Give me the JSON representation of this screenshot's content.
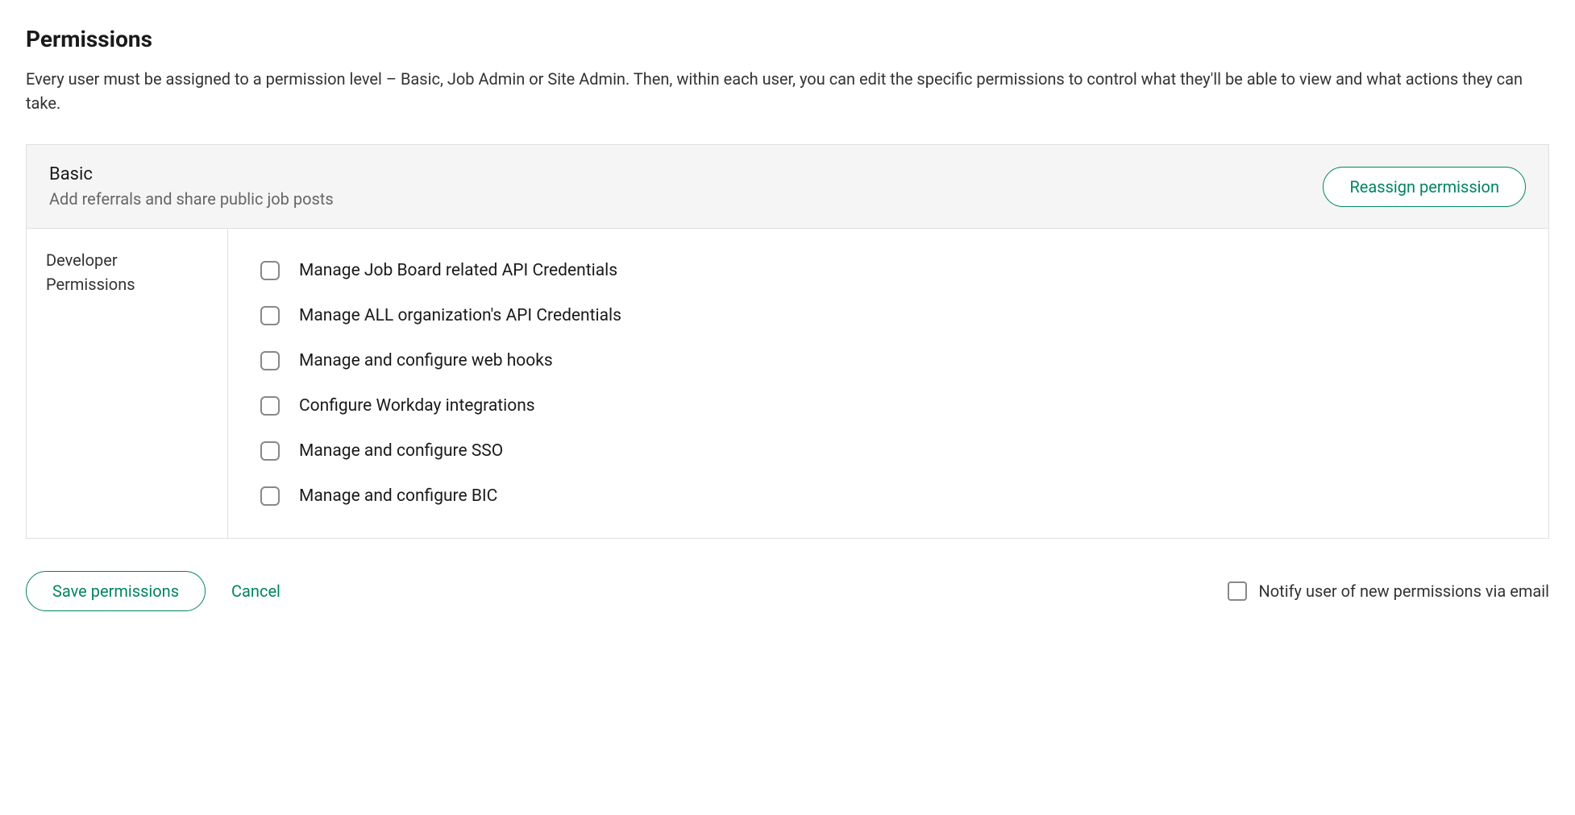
{
  "header": {
    "title": "Permissions",
    "description": "Every user must be assigned to a permission level – Basic, Job Admin or Site Admin. Then, within each user, you can edit the specific permissions to control what they'll be able to view and what actions they can take."
  },
  "panel": {
    "title": "Basic",
    "subtitle": "Add referrals and share public job posts",
    "reassign_label": "Reassign permission"
  },
  "sidebar": {
    "items": [
      {
        "label": "Developer Permissions"
      }
    ]
  },
  "permissions": [
    {
      "label": "Manage Job Board related API Credentials",
      "checked": false
    },
    {
      "label": "Manage ALL organization's API Credentials",
      "checked": false
    },
    {
      "label": "Manage and configure web hooks",
      "checked": false
    },
    {
      "label": "Configure Workday integrations",
      "checked": false
    },
    {
      "label": "Manage and configure SSO",
      "checked": false
    },
    {
      "label": "Manage and configure BIC",
      "checked": false
    }
  ],
  "footer": {
    "save_label": "Save permissions",
    "cancel_label": "Cancel",
    "notify_label": "Notify user of new permissions via email",
    "notify_checked": false
  }
}
